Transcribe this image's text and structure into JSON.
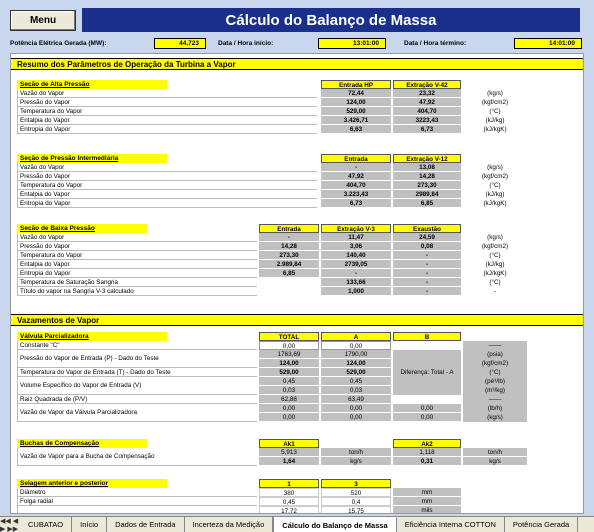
{
  "header": {
    "menu_label": "Menu",
    "title": "Cálculo do Balanço de Massa",
    "potencia_label": "Potência Elétrica Gerada (MW):",
    "potencia_value": "44,723",
    "inicio_label": "Data  /  Hora início:",
    "inicio_value": "13:01:00",
    "termino_label": "Data  /  Hora término:",
    "termino_value": "14:01:00"
  },
  "resumo": {
    "title": "Resumo dos Parâmetros de Operação da Turbina a Vapor"
  },
  "alta": {
    "title": "Seção de Alta Pressão",
    "col1": "Entrada HP",
    "col2": "Extração V-42",
    "rows": [
      {
        "label": "Vazão do Vapor",
        "v1": "72,44",
        "v2": "23,32",
        "unit": "(kg/s)"
      },
      {
        "label": "Pressão do Vapor",
        "v1": "124,00",
        "v2": "47,92",
        "unit": "(kgf/cm2)"
      },
      {
        "label": "Temperatura do Vapor",
        "v1": "529,00",
        "v2": "404,70",
        "unit": "(°C)"
      },
      {
        "label": "Entalpia do Vapor",
        "v1": "3.426,71",
        "v2": "3223,43",
        "unit": "(kJ/kg)"
      },
      {
        "label": "Entropia do Vapor",
        "v1": "6,63",
        "v2": "6,73",
        "unit": "(kJ/kgK)"
      }
    ]
  },
  "inter": {
    "title": "Seção de Pressão Intermediária",
    "col1": "Entrada",
    "col2": "Extração V-12",
    "rows": [
      {
        "label": "Vazão do Vapor",
        "v1": "-",
        "v2": "13,08",
        "unit": "(kg/s)"
      },
      {
        "label": "Pressão do Vapor",
        "v1": "47,92",
        "v2": "14,28",
        "unit": "(kgf/cm2)"
      },
      {
        "label": "Temperatura do Vapor",
        "v1": "404,70",
        "v2": "273,30",
        "unit": "(°C)"
      },
      {
        "label": "Entalpia do Vapor",
        "v1": "3.223,43",
        "v2": "2989,84",
        "unit": "(kJ/kg)"
      },
      {
        "label": "Entropia do Vapor",
        "v1": "6,73",
        "v2": "6,85",
        "unit": "(kJ/kgK)"
      }
    ]
  },
  "baixa": {
    "title": "Seção de Baixa Pressão",
    "col1": "Entrada",
    "col2": "Extração V-3",
    "col3": "Exaustão",
    "rows": [
      {
        "label": "Vazão do Vapor",
        "v1": "-",
        "v2": "11,47",
        "v3": "24,59",
        "unit": "(kg/s)"
      },
      {
        "label": "Pressão do Vapor",
        "v1": "14,28",
        "v2": "3,06",
        "v3": "0,08",
        "unit": "(kgf/cm2)"
      },
      {
        "label": "Temperatura do Vapor",
        "v1": "273,30",
        "v2": "140,40",
        "v3": "-",
        "unit": "(°C)"
      },
      {
        "label": "Entalpia do Vapor",
        "v1": "2.989,84",
        "v2": "2739,05",
        "v3": "-",
        "unit": "(kJ/kg)"
      },
      {
        "label": "Entropia do Vapor",
        "v1": "6,85",
        "v2": "-",
        "v3": "-",
        "unit": "(kJ/kgK)"
      },
      {
        "label": "Temperatura de Saturação Sangria",
        "v1": "",
        "v2": "133,66",
        "v3": "-",
        "unit": "(°C)"
      },
      {
        "label": "Título do vapor na Sangria V-3 calculado",
        "v1": "",
        "v2": "1,000",
        "v3": "-",
        "unit": "-"
      }
    ]
  },
  "vazamentos": {
    "title": "Vazamentos de Vapor"
  },
  "valvula": {
    "title": "Válvula Parcializadora",
    "col_total": "TOTAL",
    "col_a": "A",
    "col_b": "B",
    "constante_label": "Constante \"C\"",
    "constante_total": "0,00",
    "constante_a": "0,00",
    "constante_unit": "——",
    "pressao_label": "Pressão do Vapor de Entrada (P) - Dado do Teste",
    "pressao_r1_total": "1763,69",
    "pressao_r1_a": "1790,00",
    "pressao_r1_unit": "(psia)",
    "pressao_r2_total": "124,00",
    "pressao_r2_a": "124,00",
    "pressao_r2_unit": "(kgf/cm2)",
    "temp_label": "Temperatura do Vapor de Entrada (T) - Dado do Teste",
    "temp_r1_total": "529,00",
    "temp_r1_a": "529,00",
    "temp_r1_unit": "(°C)",
    "diferenca_text": "Diferença:  Total - A",
    "volume_label": "Volume Específico do Vapor de Entrada (V)",
    "volume_r1_total": "0,45",
    "volume_r1_a": "0,45",
    "volume_r1_unit": "(pé³/lb)",
    "volume_r2_total": "0,03",
    "volume_r2_a": "0,03",
    "volume_r2_unit": "(m³/kg)",
    "raiz_label": "Raiz Quadrada de (P/V)",
    "raiz_total": "62,88",
    "raiz_a": "63,49",
    "raiz_unit": "——",
    "vazao_label": "Vazão de Vapor da Válvula Parcializadora",
    "vazao_r1_total": "0,00",
    "vazao_r1_a": "0,00",
    "vazao_r1_b": "0,00",
    "vazao_r1_unit": "(lb/h)",
    "vazao_r2_total": "0,00",
    "vazao_r2_a": "0,00",
    "vazao_r2_b": "0,00",
    "vazao_r2_unit": "(kg/s)"
  },
  "buchas": {
    "title": "Buchas de Compensação",
    "col1": "Ak1",
    "col2": "Ak2",
    "label": "Vazão de Vapor para a Bucha de Compensação",
    "r1_v1": "5,913",
    "r1_u1": "ton/h",
    "r1_v2": "1,118",
    "r1_u2": "ton/h",
    "r2_v1": "1,64",
    "r2_u1": "kg/s",
    "r2_v2": "0,31",
    "r2_u2": "kg/s"
  },
  "selagem": {
    "title": "Selagem anterior e posterior",
    "col1": "1",
    "col2": "3",
    "rows": [
      {
        "label": "Diâmetro",
        "v1": "380",
        "v2": "520",
        "unit": "mm"
      },
      {
        "label": "Folga radial",
        "v1": "0,45",
        "v2": "0,4",
        "unit": "mm"
      },
      {
        "label": "",
        "v1": "17,72",
        "v2": "15,75",
        "unit": "mils"
      }
    ]
  },
  "tabs": [
    "CUBATAO",
    "Início",
    "Dados de Entrada",
    "Incerteza da Medição",
    "Cálculo do Balanço de Massa",
    "Eficiência Interna COTTON",
    "Potência Gerada"
  ],
  "active_tab": "Cálculo do Balanço de Massa"
}
